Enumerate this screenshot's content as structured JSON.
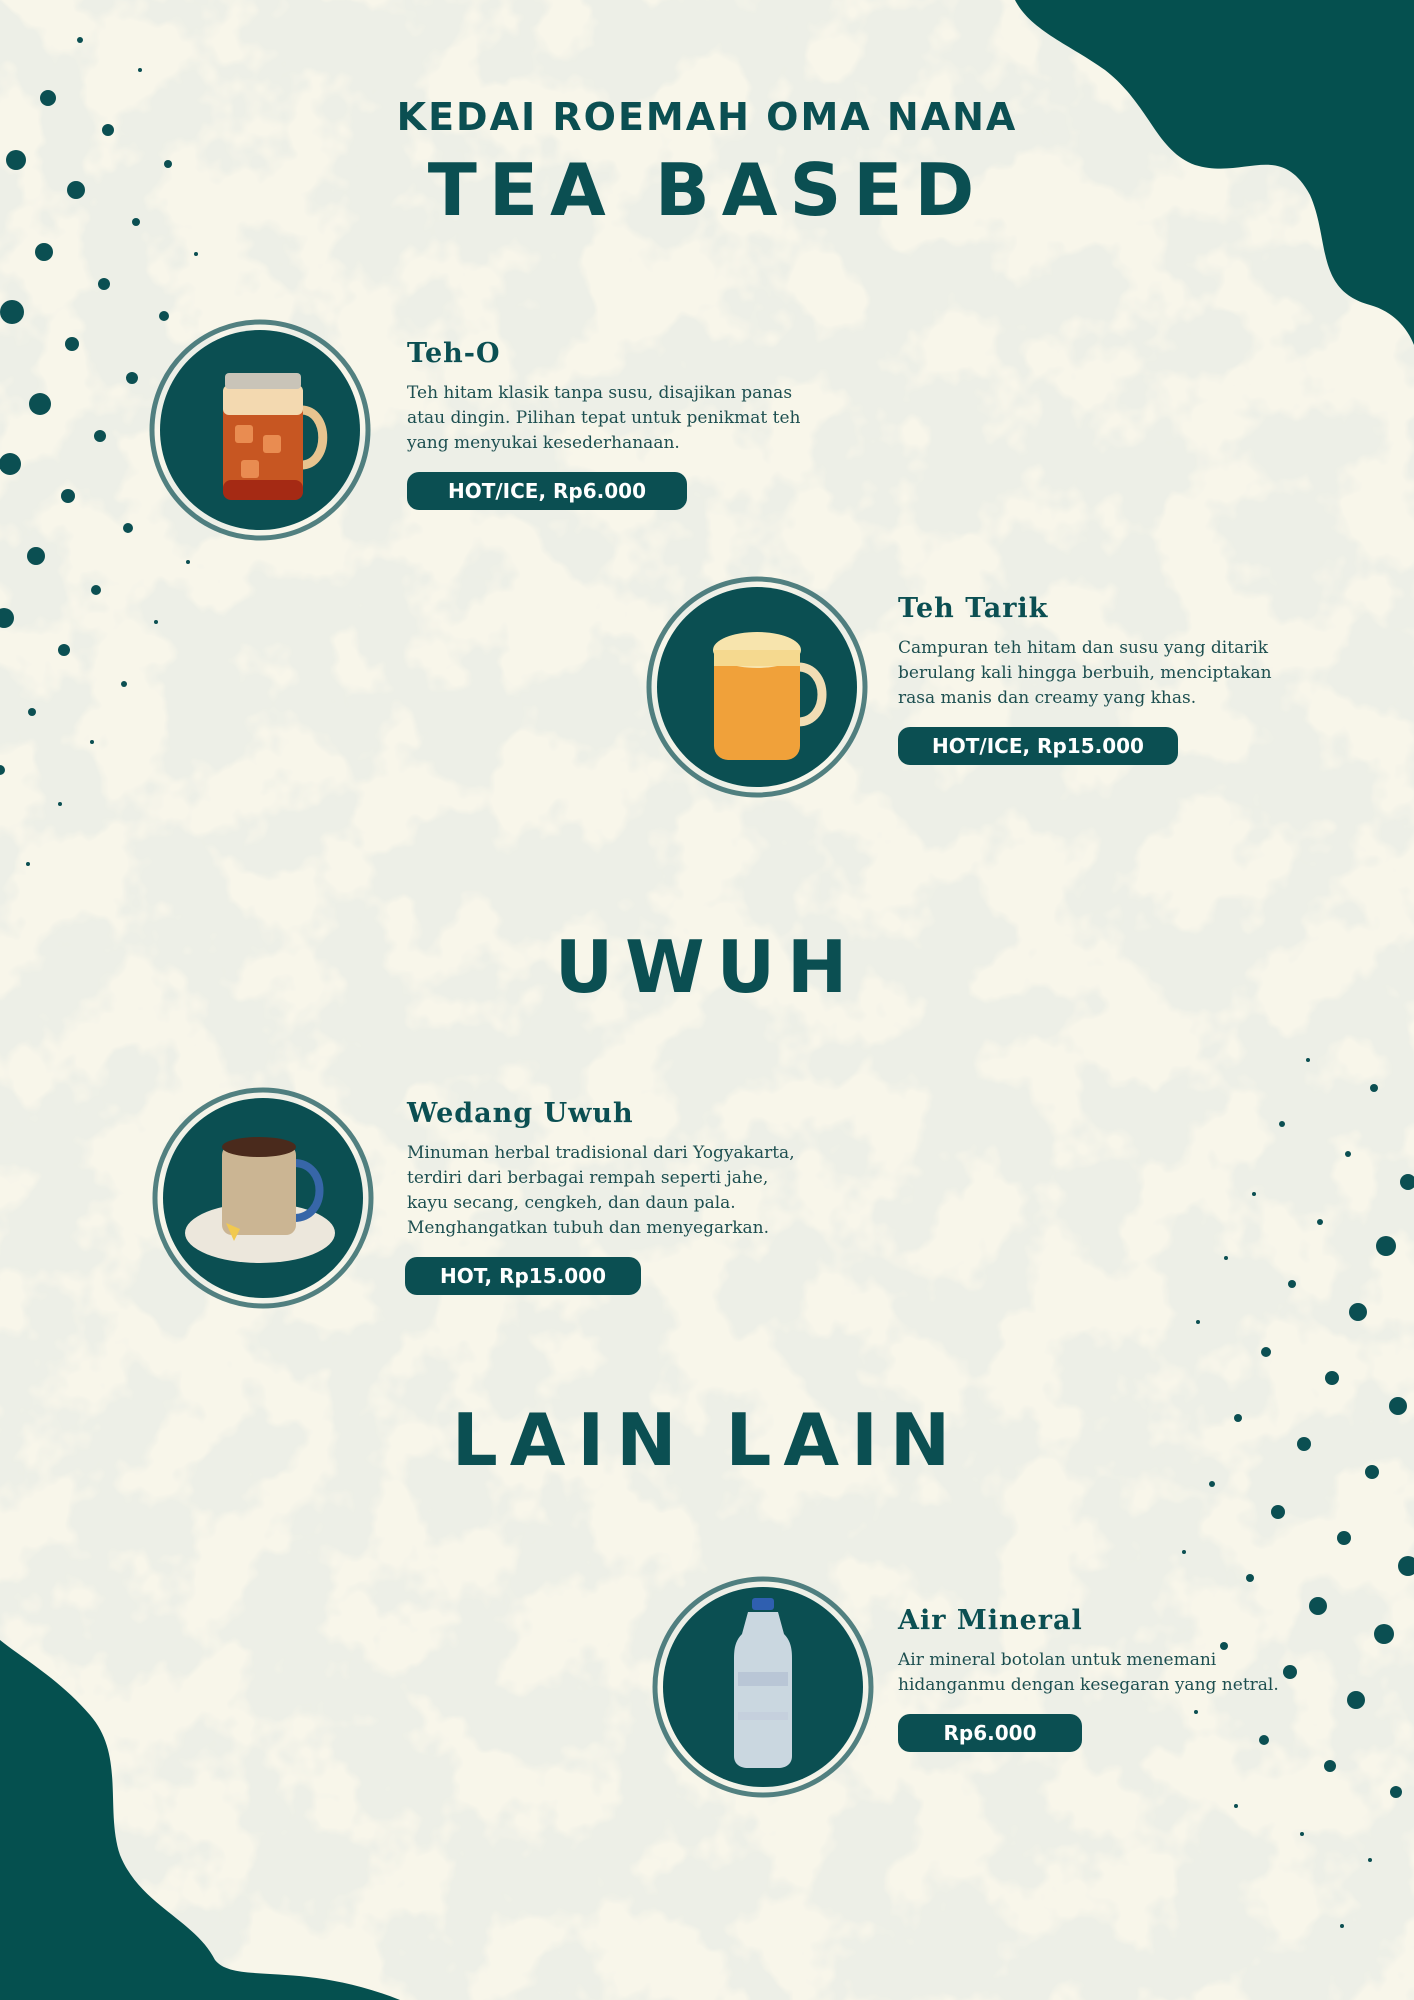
{
  "header": {
    "brand": "KEDAI ROEMAH OMA NANA"
  },
  "sections": {
    "tea_based": "TEA BASED",
    "uwuh": "UWUH",
    "lain_lain": "LAIN LAIN"
  },
  "items": [
    {
      "name": "Teh-O",
      "desc": "Teh hitam klasik tanpa susu, disajikan panas atau dingin. Pilihan tepat untuk penikmat teh yang menyukai kesederhanaan.",
      "price": "HOT/ICE, Rp6.000",
      "icon": "iced-tea-mug-icon"
    },
    {
      "name": "Teh Tarik",
      "desc": "Campuran teh hitam dan susu yang ditarik berulang kali hingga berbuih, menciptakan rasa manis dan creamy yang khas.",
      "price": "HOT/ICE, Rp15.000",
      "icon": "milk-tea-mug-icon"
    },
    {
      "name": "Wedang Uwuh",
      "desc": "Minuman herbal tradisional dari Yogyakarta, terdiri dari berbagai rempah seperti jahe, kayu secang, cengkeh, dan daun pala. Menghangatkan tubuh dan menyegarkan.",
      "price": "HOT, Rp15.000",
      "icon": "herbal-drink-cup-icon"
    },
    {
      "name": "Air Mineral",
      "desc": "Air mineral botolan untuk menemani hidanganmu dengan kesegaran yang netral.",
      "price": "Rp6.000",
      "icon": "water-bottle-icon"
    }
  ],
  "colors": {
    "accent": "#0b4f52",
    "background": "#f8f6ea",
    "price_text": "#ffffff"
  }
}
